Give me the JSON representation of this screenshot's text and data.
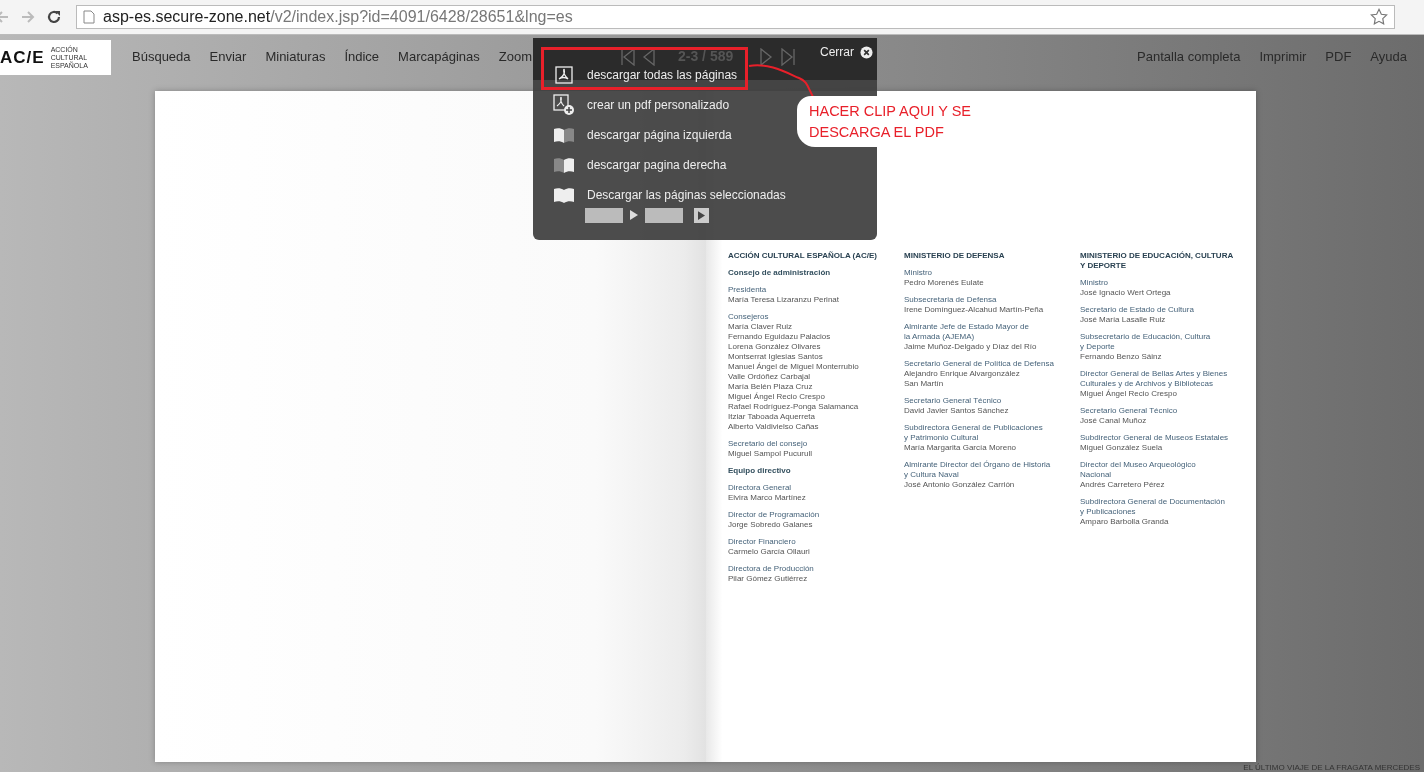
{
  "browser": {
    "url_host": "asp-es.secure-zone.net",
    "url_path": "/v2/index.jsp?id=4091/6428/28651&lng=es"
  },
  "toolbar": {
    "logo": "AC/E",
    "logo_sub": "ACCIÓN CULTURAL ESPAÑOLA",
    "nav_items": [
      "Búsqueda",
      "Enviar",
      "Miniaturas",
      "Índice",
      "Marcapáginas",
      "Zoom"
    ],
    "right_items": [
      "Pantalla completa",
      "Imprimir",
      "PDF",
      "Ayuda"
    ]
  },
  "viewer": {
    "pager": "2-3 / 589",
    "close": "Cerrar"
  },
  "download_menu": {
    "items": [
      {
        "kind": "pdf",
        "label": "descargar todas las páginas"
      },
      {
        "kind": "custom",
        "label": "crear un pdf personalizado"
      },
      {
        "kind": "left",
        "label": "descargar página izquierda"
      },
      {
        "kind": "right",
        "label": "descargar pagina derecha"
      },
      {
        "kind": "both",
        "label": "Descargar las páginas seleccionadas"
      }
    ]
  },
  "annotation": {
    "text": "HACER CLIP AQUI Y SE DESCARGA EL PDF"
  },
  "page_columns": [
    {
      "heading": [
        "ACCIÓN CULTURAL ESPAÑOLA (AC/E)"
      ],
      "groups": [
        {
          "kind": "section",
          "role": [
            "Consejo de administración"
          ]
        },
        {
          "kind": "role",
          "role": [
            "Presidenta"
          ],
          "names": [
            "María Teresa Lizaranzu Perinat"
          ]
        },
        {
          "kind": "role",
          "role": [
            "Consejeros"
          ],
          "names": [
            "María Claver Ruiz",
            "Fernando Eguidazu Palacios",
            "Lorena González Olivares",
            "Montserrat Iglesias Santos",
            "Manuel Ángel de Miguel Monterrubio",
            "Valle Ordóñez Carbajal",
            "María Belén Plaza Cruz",
            "Miguel Ángel Recio Crespo",
            "Rafael Rodríguez-Ponga Salamanca",
            "Itziar Taboada Aquerreta",
            "Alberto Valdivielso Cañas"
          ]
        },
        {
          "kind": "role",
          "role": [
            "Secretario del consejo"
          ],
          "names": [
            "Miguel Sampol Pucurull"
          ]
        },
        {
          "kind": "section",
          "role": [
            "Equipo directivo"
          ]
        },
        {
          "kind": "role",
          "role": [
            "Directora General"
          ],
          "names": [
            "Elvira Marco Martínez"
          ]
        },
        {
          "kind": "role",
          "role": [
            "Director de Programación"
          ],
          "names": [
            "Jorge Sobredo Galanes"
          ]
        },
        {
          "kind": "role",
          "role": [
            "Director Financiero"
          ],
          "names": [
            "Carmelo García Ollauri"
          ]
        },
        {
          "kind": "role",
          "role": [
            "Directora de Producción"
          ],
          "names": [
            "Pilar Gómez Gutiérrez"
          ]
        }
      ]
    },
    {
      "heading": [
        "MINISTERIO DE DEFENSA"
      ],
      "groups": [
        {
          "kind": "role",
          "role": [
            "Ministro"
          ],
          "names": [
            "Pedro Morenés Eulate"
          ]
        },
        {
          "kind": "role",
          "role": [
            "Subsecretaria de Defensa"
          ],
          "names": [
            "Irene Domínguez-Alcahud Martín-Peña"
          ]
        },
        {
          "kind": "role",
          "role": [
            "Almirante Jefe de Estado Mayor de",
            "la Armada (AJEMA)"
          ],
          "names": [
            "Jaime Muñoz-Delgado y Díaz del Río"
          ]
        },
        {
          "kind": "role",
          "role": [
            "Secretario General de Política de Defensa"
          ],
          "names": [
            "Alejandro Enrique Alvargonzález",
            "San Martín"
          ]
        },
        {
          "kind": "role",
          "role": [
            "Secretario General Técnico"
          ],
          "names": [
            "David Javier Santos Sánchez"
          ]
        },
        {
          "kind": "role",
          "role": [
            "Subdirectora General de Publicaciones",
            "y Patrimonio Cultural"
          ],
          "names": [
            "María Margarita García Moreno"
          ]
        },
        {
          "kind": "role",
          "role": [
            "Almirante Director del Órgano de Historia",
            "y Cultura Naval"
          ],
          "names": [
            "José Antonio González Carrión"
          ]
        }
      ]
    },
    {
      "heading": [
        "MINISTERIO DE EDUCACIÓN, CULTURA",
        "Y DEPORTE"
      ],
      "groups": [
        {
          "kind": "role",
          "role": [
            "Ministro"
          ],
          "names": [
            "José Ignacio Wert Ortega"
          ]
        },
        {
          "kind": "role",
          "role": [
            "Secretario de Estado de Cultura"
          ],
          "names": [
            "José María Lasalle Ruiz"
          ]
        },
        {
          "kind": "role",
          "role": [
            "Subsecretario de Educación, Cultura",
            "y Deporte"
          ],
          "names": [
            "Fernando Benzo Sáinz"
          ]
        },
        {
          "kind": "role",
          "role": [
            "Director General de Bellas Artes y Bienes",
            "Culturales y de Archivos y Bibliotecas"
          ],
          "names": [
            "Miguel Ángel Recio Crespo"
          ]
        },
        {
          "kind": "role",
          "role": [
            "Secretario General Técnico"
          ],
          "names": [
            "José Canal Muñoz"
          ]
        },
        {
          "kind": "role",
          "role": [
            "Subdirector General de Museos Estatales"
          ],
          "names": [
            "Miguel González Suela"
          ]
        },
        {
          "kind": "role",
          "role": [
            "Director del Museo Arqueológico",
            "Nacional"
          ],
          "names": [
            "Andrés Carretero Pérez"
          ]
        },
        {
          "kind": "role",
          "role": [
            "Subdirectora General de Documentación",
            "y Publicaciones"
          ],
          "names": [
            "Amparo Barbolla Granda"
          ]
        }
      ]
    }
  ],
  "caption": "EL ÚLTIMO VIAJE DE LA FRAGATA MERCEDES"
}
